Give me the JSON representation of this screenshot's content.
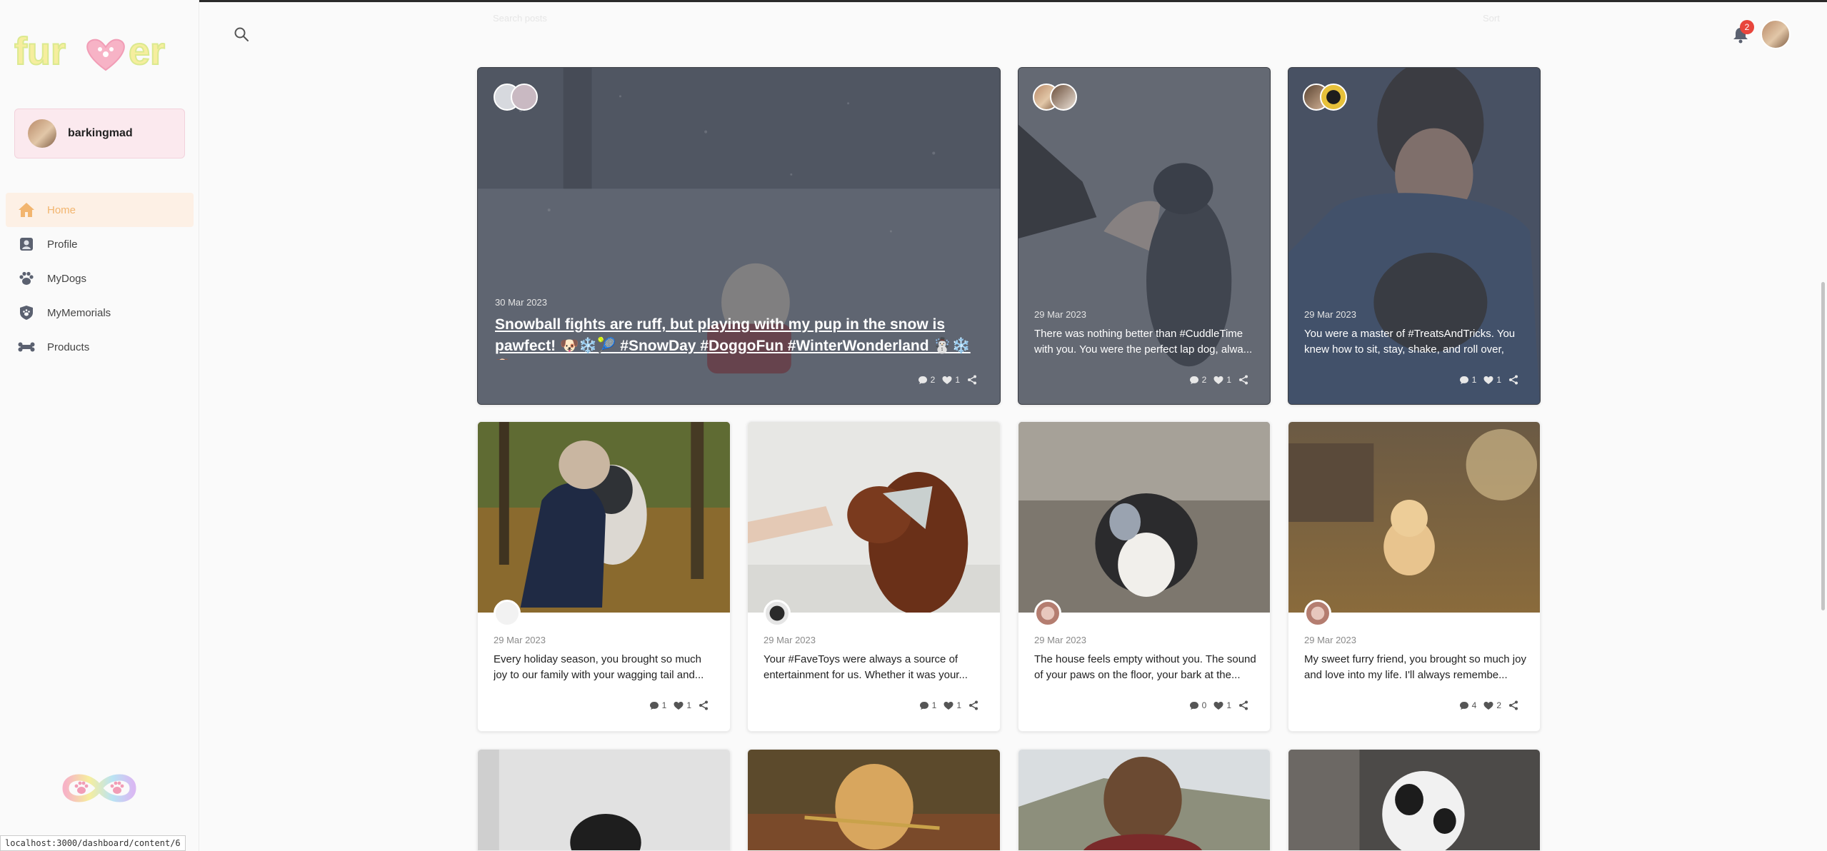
{
  "app": {
    "brand": "furever",
    "status_url": "localhost:3000/dashboard/content/6",
    "ghost_text_left": "Search posts",
    "ghost_text_right": "Sort"
  },
  "user": {
    "name": "barkingmad"
  },
  "nav": [
    {
      "label": "Home",
      "icon": "home-icon",
      "active": true
    },
    {
      "label": "Profile",
      "icon": "profile-icon",
      "active": false
    },
    {
      "label": "MyDogs",
      "icon": "paw-icon",
      "active": false
    },
    {
      "label": "MyMemorials",
      "icon": "shield-paw-icon",
      "active": false
    },
    {
      "label": "Products",
      "icon": "bone-icon",
      "active": false
    }
  ],
  "header": {
    "notification_count": "2"
  },
  "colors": {
    "accent": "#f2b56f",
    "active_bg": "#fdf0e5",
    "user_card_bg": "#fbe9ee",
    "badge": "#e8453c"
  },
  "posts": [
    {
      "date": "30 Mar 2023",
      "text": "Snowball fights are ruff, but playing with my pup in the snow is pawfect! 🐶❄️🎾 #SnowDay #DoggoFun #WinterWonderland ☃️❄️🐕",
      "comments": "2",
      "likes": "1"
    },
    {
      "date": "29 Mar 2023",
      "text": "There was nothing better than #CuddleTime with you. You were the perfect lap dog, alwa...",
      "comments": "2",
      "likes": "1"
    },
    {
      "date": "29 Mar 2023",
      "text": "You were a master of #TreatsAndTricks. You knew how to sit, stay, shake, and roll over, an...",
      "comments": "1",
      "likes": "1"
    },
    {
      "date": "29 Mar 2023",
      "text": "Every holiday season, you brought so much joy to our family with your wagging tail and...",
      "comments": "1",
      "likes": "1"
    },
    {
      "date": "29 Mar 2023",
      "text": "Your #FaveToys were always a source of entertainment for us. Whether it was your...",
      "comments": "1",
      "likes": "1"
    },
    {
      "date": "29 Mar 2023",
      "text": "The house feels empty without you. The sound of your paws on the floor, your bark at the...",
      "comments": "0",
      "likes": "1"
    },
    {
      "date": "29 Mar 2023",
      "text": "My sweet furry friend, you brought so much joy and love into my life. I'll always remembe...",
      "comments": "4",
      "likes": "2"
    }
  ]
}
